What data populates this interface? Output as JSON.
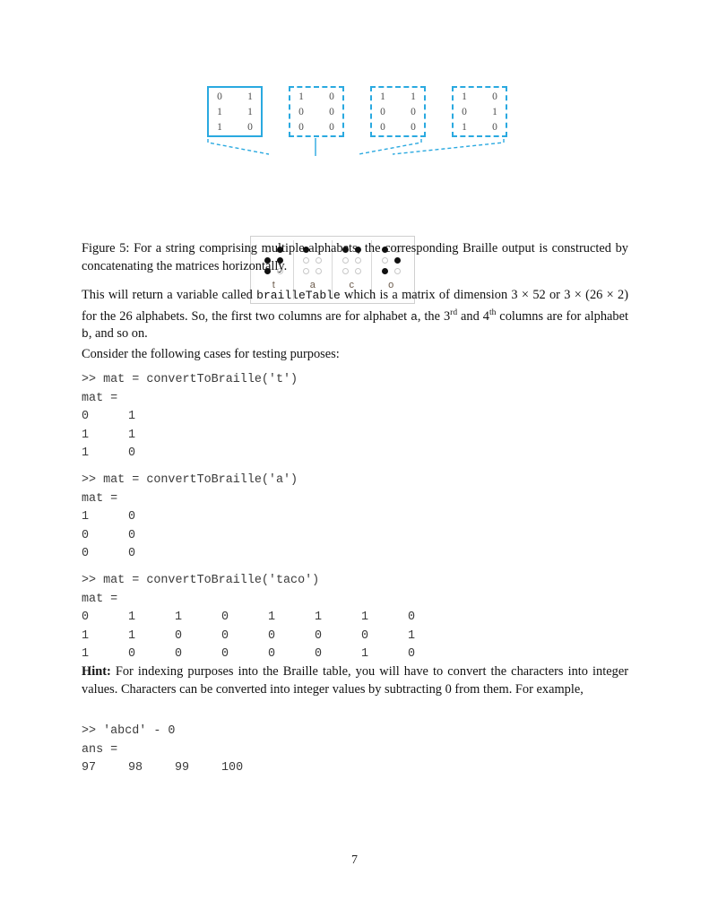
{
  "figure": {
    "matrices": [
      {
        "label": "matrix-t",
        "style": "solid",
        "rows": [
          [
            "0",
            "1"
          ],
          [
            "1",
            "1"
          ],
          [
            "1",
            "0"
          ]
        ]
      },
      {
        "label": "matrix-a",
        "style": "dashed",
        "rows": [
          [
            "1",
            "0"
          ],
          [
            "0",
            "0"
          ],
          [
            "0",
            "0"
          ]
        ]
      },
      {
        "label": "matrix-c",
        "style": "dashed",
        "rows": [
          [
            "1",
            "1"
          ],
          [
            "0",
            "0"
          ],
          [
            "0",
            "0"
          ]
        ]
      },
      {
        "label": "matrix-o",
        "style": "dashed",
        "rows": [
          [
            "1",
            "0"
          ],
          [
            "0",
            "1"
          ],
          [
            "1",
            "0"
          ]
        ]
      }
    ],
    "accent_color": "#2aa9e0",
    "braille_cells": [
      {
        "letter": "t",
        "dots": [
          [
            0,
            1
          ],
          [
            1,
            1
          ],
          [
            1,
            0
          ]
        ]
      },
      {
        "letter": "a",
        "dots": [
          [
            1,
            0
          ],
          [
            0,
            0
          ],
          [
            0,
            0
          ]
        ]
      },
      {
        "letter": "c",
        "dots": [
          [
            1,
            1
          ],
          [
            0,
            0
          ],
          [
            0,
            0
          ]
        ]
      },
      {
        "letter": "o",
        "dots": [
          [
            1,
            0
          ],
          [
            0,
            1
          ],
          [
            1,
            0
          ]
        ]
      }
    ]
  },
  "caption": {
    "label": "Figure 5:",
    "text": " For a string comprising multiple alphabets, the corresponding Braille output is constructed by concatenating the matrices horizontally."
  },
  "paragraphs": {
    "p1_part1": "This will return a variable called ",
    "p1_code": "brailleTable",
    "p1_part2": " which is a matrix of dimension 3 × 52 or 3 × (26 × 2) for the 26 alphabets. So, the first two columns are for alphabet ",
    "p1_alpha_a": "a",
    "p1_part3": ", the 3",
    "p1_sup1": "rd",
    "p1_part4": " and 4",
    "p1_sup2": "th",
    "p1_part5": " columns are for alphabet ",
    "p1_alpha_b": "b",
    "p1_part6": ", and so on.",
    "p2": "Consider the following cases for testing purposes:",
    "hint_label": "Hint:",
    "hint_text": " For indexing purposes into the Braille table, you will have to convert the characters into integer values. Characters can be converted into integer values by subtracting 0 from them. For example,"
  },
  "code_blocks": [
    {
      "name": "convert-t",
      "prompt": ">> mat = convertToBraille('t')",
      "result_label": "mat =",
      "rows": [
        [
          "0",
          "1"
        ],
        [
          "1",
          "1"
        ],
        [
          "1",
          "0"
        ]
      ]
    },
    {
      "name": "convert-a",
      "prompt": ">> mat = convertToBraille('a')",
      "result_label": "mat =",
      "rows": [
        [
          "1",
          "0"
        ],
        [
          "0",
          "0"
        ],
        [
          "0",
          "0"
        ]
      ]
    },
    {
      "name": "convert-taco",
      "prompt": ">> mat = convertToBraille('taco')",
      "result_label": "mat =",
      "rows": [
        [
          "0",
          "1",
          "1",
          "0",
          "1",
          "1",
          "1",
          "0"
        ],
        [
          "1",
          "1",
          "0",
          "0",
          "0",
          "0",
          "0",
          "1"
        ],
        [
          "1",
          "0",
          "0",
          "0",
          "0",
          "0",
          "1",
          "0"
        ]
      ]
    },
    {
      "name": "abcd-minus-zero",
      "prompt": ">> 'abcd' - 0",
      "result_label": "ans =",
      "rows": [
        [
          "97",
          "98",
          "99",
          "100"
        ]
      ]
    }
  ],
  "footer": {
    "page_number": "7"
  }
}
